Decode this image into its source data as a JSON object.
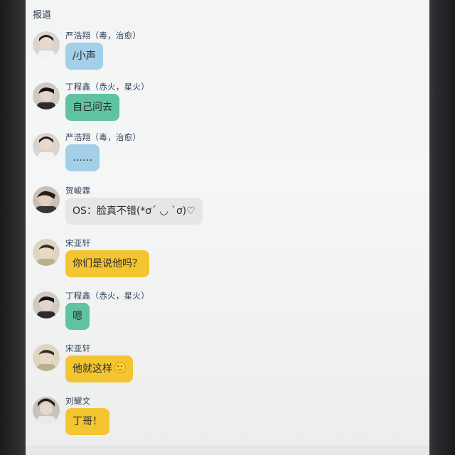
{
  "header": {
    "title": "报道"
  },
  "messages": [
    {
      "sender": "严浩翔（毒，治愈）",
      "text": "/小声",
      "color": "#a3cfe8"
    },
    {
      "sender": "丁程鑫（赤火，星火）",
      "text": "自己问去",
      "color": "#5fc2a3"
    },
    {
      "sender": "严浩翔（毒，治愈）",
      "text": "……",
      "color": "#a3cfe8"
    },
    {
      "sender": "贺峻霖",
      "text": "OS：脸真不错(*ơ´ ◡ `ơ)♡",
      "color": "#e6e6e6"
    },
    {
      "sender": "宋亚轩",
      "text": "你们是说他吗？",
      "color": "#f3c531"
    },
    {
      "sender": "丁程鑫（赤火，星火）",
      "text": "嗯",
      "color": "#5fc2a3"
    },
    {
      "sender": "宋亚轩",
      "text": "他就这样",
      "emoji": "smile-emoji",
      "color": "#f3c531"
    },
    {
      "sender": "刘耀文",
      "text": "丁哥！",
      "color": "#f3c531"
    }
  ]
}
